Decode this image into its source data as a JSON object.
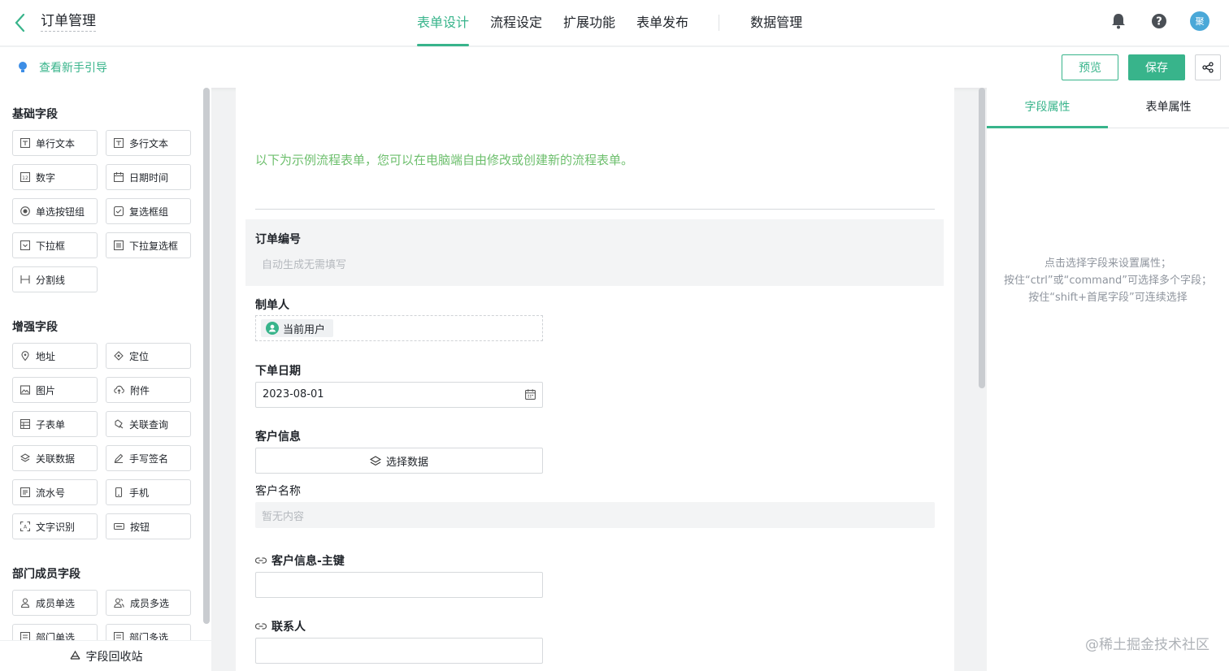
{
  "header": {
    "title": "订单管理",
    "tabs": [
      {
        "label": "表单设计",
        "active": true
      },
      {
        "label": "流程设定"
      },
      {
        "label": "扩展功能"
      },
      {
        "label": "表单发布"
      },
      {
        "label": "数据管理"
      }
    ],
    "avatar_text": "聚",
    "icons": [
      "back-arrow-icon",
      "bell-icon",
      "help-icon"
    ]
  },
  "toolbar": {
    "guide_label": "查看新手引导",
    "preview_label": "预览",
    "save_label": "保存",
    "share_icon": "share-icon"
  },
  "left_panel": {
    "groups": [
      {
        "title": "基础字段",
        "items": [
          "单行文本",
          "多行文本",
          "数字",
          "日期时间",
          "单选按钮组",
          "复选框组",
          "下拉框",
          "下拉复选框",
          "分割线"
        ]
      },
      {
        "title": "增强字段",
        "items": [
          "地址",
          "定位",
          "图片",
          "附件",
          "子表单",
          "关联查询",
          "关联数据",
          "手写签名",
          "流水号",
          "手机",
          "文字识别",
          "按钮"
        ]
      },
      {
        "title": "部门成员字段",
        "items": [
          "成员单选",
          "成员多选",
          "部门单选",
          "部门多选"
        ]
      }
    ],
    "recycle_label": "字段回收站"
  },
  "form": {
    "intro": "以下为示例流程表单，您可以在电脑端自由修改或创建新的流程表单。",
    "order_no": {
      "label": "订单编号",
      "placeholder": "自动生成无需填写"
    },
    "creator": {
      "label": "制单人",
      "value": "当前用户"
    },
    "order_date": {
      "label": "下单日期",
      "value": "2023-08-01"
    },
    "customer": {
      "label": "客户信息",
      "button": "选择数据"
    },
    "customer_name": {
      "label": "客户名称",
      "placeholder": "暂无内容"
    },
    "customer_key": {
      "label": "客户信息-主键"
    },
    "contact": {
      "label": "联系人"
    }
  },
  "right_panel": {
    "tabs": [
      {
        "label": "字段属性",
        "active": true
      },
      {
        "label": "表单属性"
      }
    ],
    "hint_lines": [
      "点击选择字段来设置属性；",
      "按住“ctrl”或“command”可选择多个字段；",
      "按住“shift+首尾字段”可连续选择"
    ]
  },
  "watermark": "@稀土掘金技术社区",
  "colors": {
    "accent": "#38b48b",
    "intro_text": "#6dbf6d"
  }
}
